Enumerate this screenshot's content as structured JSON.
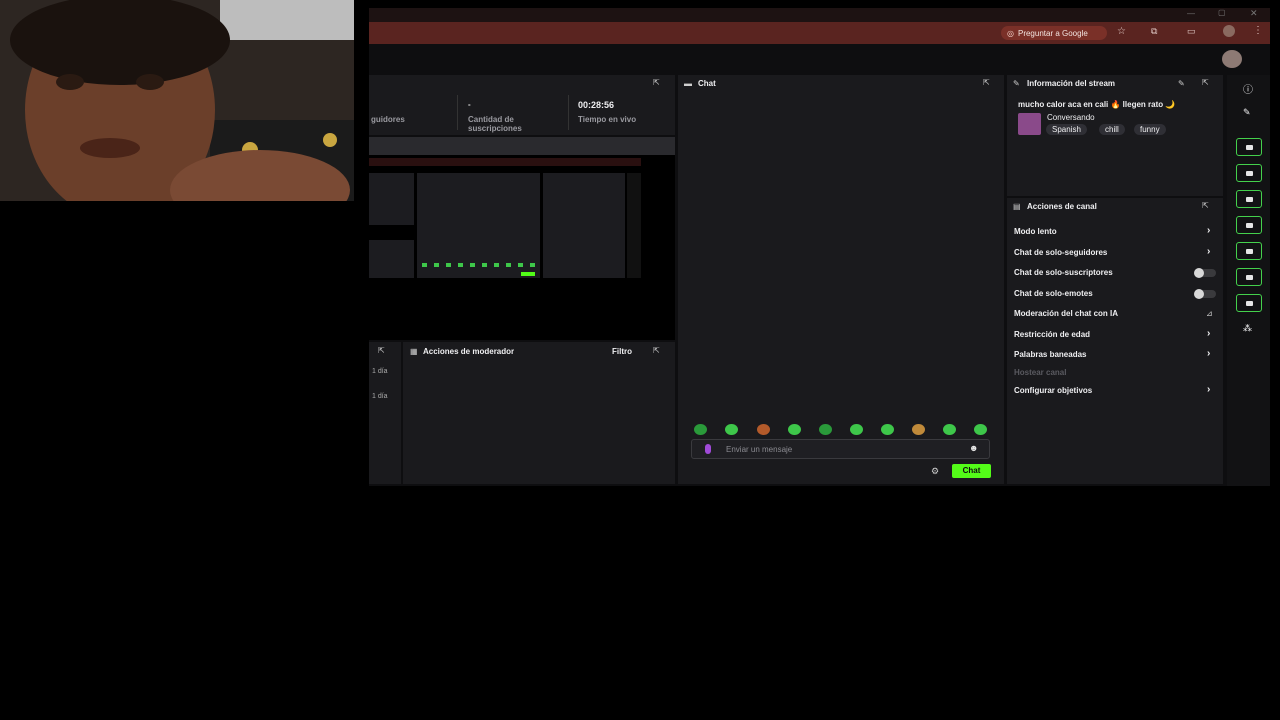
{
  "browser": {
    "ask_google": "Preguntar a Google"
  },
  "stats": {
    "followers_label": "guidores",
    "subs_value": "-",
    "subs_label": "Cantidad de suscripciones",
    "live_time_value": "00:28:56",
    "live_time_label": "Tiempo en vivo"
  },
  "chat": {
    "title": "Chat",
    "input_placeholder": "Enviar un mensaje",
    "send_label": "Chat"
  },
  "stream_info": {
    "title": "Información del stream",
    "stream_title": "mucho calor aca en cali 🔥 llegen rato 🌙",
    "category": "Conversando",
    "tags": [
      "Spanish",
      "chill",
      "funny"
    ]
  },
  "channel_actions": {
    "title": "Acciones de canal",
    "items": [
      {
        "label": "Modo lento",
        "control": "chevron"
      },
      {
        "label": "Chat de solo-seguidores",
        "control": "chevron"
      },
      {
        "label": "Chat de solo-suscriptores",
        "control": "toggle"
      },
      {
        "label": "Chat de solo-emotes",
        "control": "toggle"
      },
      {
        "label": "Moderación del chat con IA",
        "control": "chart"
      },
      {
        "label": "Restricción de edad",
        "control": "chevron"
      },
      {
        "label": "Palabras baneadas",
        "control": "chevron"
      },
      {
        "label": "Hostear canal",
        "control": "disabled"
      },
      {
        "label": "Configurar objetivos",
        "control": "chevron"
      }
    ]
  },
  "mod_actions": {
    "title": "Acciones de moderador",
    "filter_label": "Filtro",
    "left_items": [
      "1 día",
      "1 día"
    ]
  },
  "colors": {
    "accent": "#53fc18",
    "sidebar_icon_border": "#44d14c",
    "address_bar": "#5a2420"
  }
}
